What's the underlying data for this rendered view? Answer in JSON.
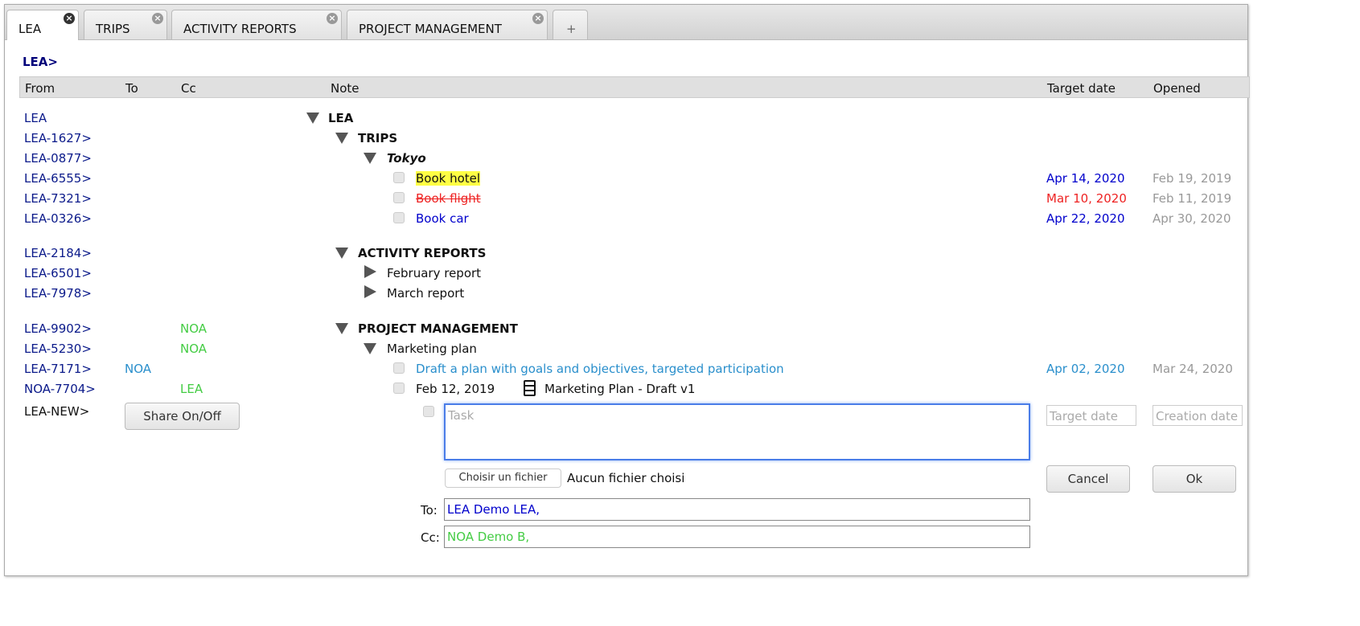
{
  "tabs": [
    {
      "label": "LEA",
      "active": true
    },
    {
      "label": "TRIPS"
    },
    {
      "label": "ACTIVITY REPORTS"
    },
    {
      "label": "PROJECT MANAGEMENT"
    },
    {
      "label": "+"
    }
  ],
  "breadcrumb": "LEA>",
  "columns": {
    "from": "From",
    "to": "To",
    "cc": "Cc",
    "note": "Note",
    "target": "Target date",
    "opened": "Opened"
  },
  "rows": [
    {
      "from": "LEA",
      "level": 0,
      "type": "group",
      "text": "LEA",
      "expanded": true
    },
    {
      "from": "LEA-1627>",
      "level": 1,
      "type": "group",
      "text": "TRIPS",
      "expanded": true
    },
    {
      "from": "LEA-0877>",
      "level": 2,
      "type": "group",
      "text": "Tokyo",
      "italic": true,
      "expanded": true
    },
    {
      "from": "LEA-6555>",
      "type": "task",
      "text": "Book hotel",
      "highlight": true,
      "target": "Apr 14, 2020",
      "target_color": "#0000cc",
      "opened": "Feb 19, 2019"
    },
    {
      "from": "LEA-7321>",
      "type": "task",
      "text": "Book flight",
      "strike": true,
      "color": "#ee2222",
      "target": "Mar 10, 2020",
      "target_color": "#ee2222",
      "opened": "Feb 11, 2019"
    },
    {
      "from": "LEA-0326>",
      "type": "task",
      "text": "Book car",
      "color": "#0000cc",
      "target": "Apr 22, 2020",
      "target_color": "#0000cc",
      "opened": "Apr 30, 2020"
    },
    {
      "from": "LEA-2184>",
      "level": 1,
      "type": "group",
      "text": "ACTIVITY REPORTS",
      "expanded": true
    },
    {
      "from": "LEA-6501>",
      "level": 2,
      "type": "item",
      "text": "February report",
      "expanded": false
    },
    {
      "from": "LEA-7978>",
      "level": 2,
      "type": "item",
      "text": "March report",
      "expanded": false
    },
    {
      "from": "LEA-9902>",
      "cc": "NOA",
      "level": 1,
      "type": "group",
      "text": "PROJECT MANAGEMENT",
      "expanded": true
    },
    {
      "from": "LEA-5230>",
      "cc": "NOA",
      "level": 2,
      "type": "item",
      "text": "Marketing plan",
      "expanded": true
    },
    {
      "from": "LEA-7171>",
      "to": "NOA",
      "type": "task",
      "text": "Draft a plan with goals and objectives, targeted participation",
      "color": "#2a8fcc",
      "target": "Apr 02, 2020",
      "target_color": "#2a8fcc",
      "opened": "Mar 24, 2020"
    },
    {
      "from": "NOA-7704>",
      "cc": "LEA",
      "type": "file",
      "date": "Feb 12, 2019",
      "text": "Marketing Plan - Draft v1"
    }
  ],
  "new_row": {
    "from": "LEA-NEW>",
    "share_label": "Share On/Off",
    "task_placeholder": "Task",
    "target_placeholder": "Target date",
    "creation_placeholder": "Creation date",
    "file_button": "Choisir un fichier",
    "file_status": "Aucun fichier choisi",
    "cancel_label": "Cancel",
    "ok_label": "Ok",
    "to_label": "To:",
    "to_value": "LEA Demo LEA,",
    "cc_label": "Cc:",
    "cc_value": "NOA Demo B,"
  },
  "colors": {
    "from": "#0b1a8a",
    "to": "#2a8fcc",
    "cc": "#44cc44",
    "opened": "#999999",
    "focus": "#4a7de8"
  }
}
